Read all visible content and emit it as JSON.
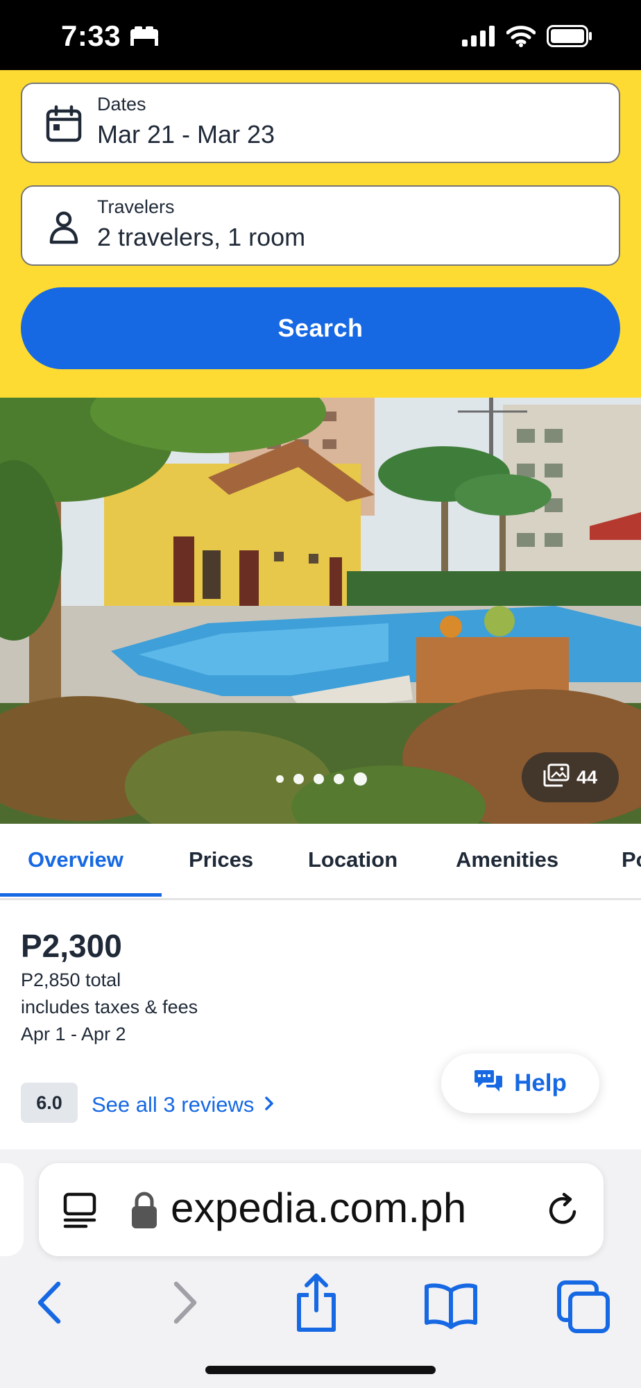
{
  "status_bar": {
    "time": "7:33",
    "icons": [
      "bed-icon",
      "cellular-signal-icon",
      "wifi-icon",
      "battery-icon"
    ]
  },
  "search": {
    "dates_label": "Dates",
    "dates_value": "Mar 21 - Mar 23",
    "travelers_label": "Travelers",
    "travelers_value": "2 travelers, 1 room",
    "search_button": "Search",
    "icons": [
      "calendar-icon",
      "person-icon"
    ]
  },
  "gallery": {
    "photo_count": "44",
    "dot_count": 5,
    "active_dot": 5
  },
  "tabs": [
    {
      "label": "Overview",
      "active": true
    },
    {
      "label": "Prices",
      "active": false
    },
    {
      "label": "Location",
      "active": false
    },
    {
      "label": "Amenities",
      "active": false
    },
    {
      "label": "Po",
      "active": false
    }
  ],
  "overview": {
    "price": "P2,300",
    "total": "P2,850 total",
    "taxes_note": "includes taxes & fees",
    "dates": "Apr 1 - Apr 2",
    "rating": "6.0",
    "reviews_link": "See all 3 reviews",
    "help_button": "Help"
  },
  "browser": {
    "url": "expedia.com.ph",
    "icons": [
      "reader-icon",
      "lock-icon",
      "reload-icon",
      "back-icon",
      "forward-icon",
      "share-icon",
      "bookmarks-icon",
      "tabs-icon"
    ]
  },
  "colors": {
    "brand_yellow": "#fddb32",
    "brand_blue": "#1668e3",
    "text_dark": "#1f2937"
  }
}
